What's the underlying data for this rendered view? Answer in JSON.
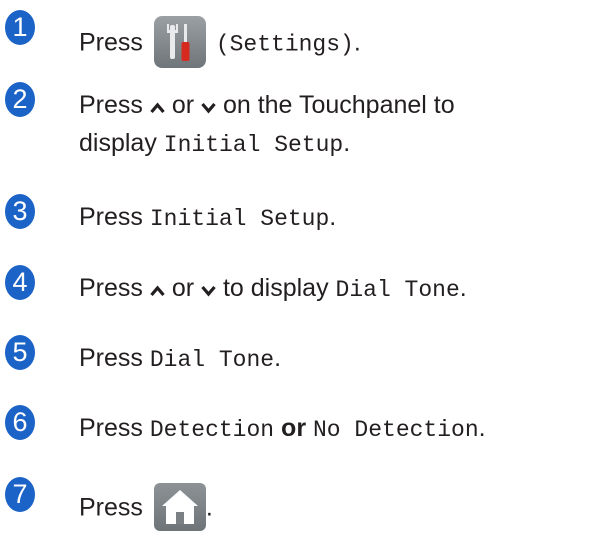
{
  "steps": [
    {
      "number": "1",
      "press": "Press",
      "settings_paren": "(Settings)",
      "period": "."
    },
    {
      "number": "2",
      "press": "Press",
      "or": "or",
      "rest1": "on the Touchpanel to",
      "display": "display",
      "setting": "Initial Setup",
      "period": "."
    },
    {
      "number": "3",
      "press": "Press",
      "setting": "Initial Setup",
      "period": "."
    },
    {
      "number": "4",
      "press": "Press",
      "or": "or",
      "to_display": "to display",
      "setting": "Dial Tone",
      "period": "."
    },
    {
      "number": "5",
      "press": "Press",
      "setting": "Dial Tone",
      "period": "."
    },
    {
      "number": "6",
      "press": "Press",
      "option1": "Detection",
      "or": "or",
      "option2": "No Detection",
      "period": "."
    },
    {
      "number": "7",
      "press": "Press",
      "period": "."
    }
  ],
  "icons": {
    "settings": "settings-icon",
    "up": "chevron-up-icon",
    "down": "chevron-down-icon",
    "home": "home-icon"
  },
  "colors": {
    "step_number_bg": "#1c63c7",
    "text": "#231f20"
  }
}
